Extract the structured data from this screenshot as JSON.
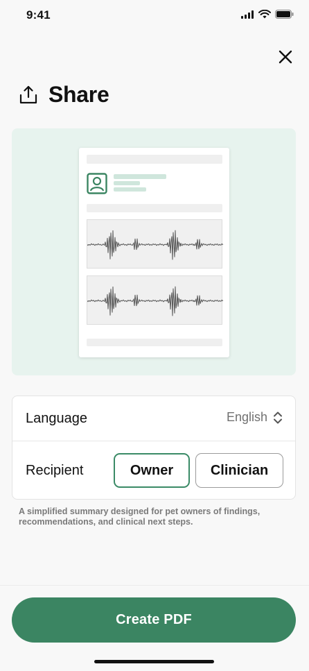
{
  "status_bar": {
    "time": "9:41",
    "icons": [
      "cellular-signal-icon",
      "wifi-icon",
      "battery-icon"
    ]
  },
  "header": {
    "title": "Share",
    "icon": "share-upload-icon",
    "close_icon": "close-icon"
  },
  "preview": {
    "panel_color": "#e7f3ee",
    "avatar_icon": "person-card-icon",
    "waveforms": 2
  },
  "settings": {
    "language": {
      "label": "Language",
      "value": "English",
      "icon": "chevron-up-down-icon"
    },
    "recipient": {
      "label": "Recipient",
      "options": [
        "Owner",
        "Clinician"
      ],
      "selected": "Owner"
    }
  },
  "helper_text": "A simplified summary designed for pet owners of findings, recommendations, and clinical next steps.",
  "footer": {
    "primary_button": "Create PDF"
  },
  "colors": {
    "accent": "#3b8562",
    "selected_border": "#3a8a66",
    "background": "#f8f8f8"
  }
}
